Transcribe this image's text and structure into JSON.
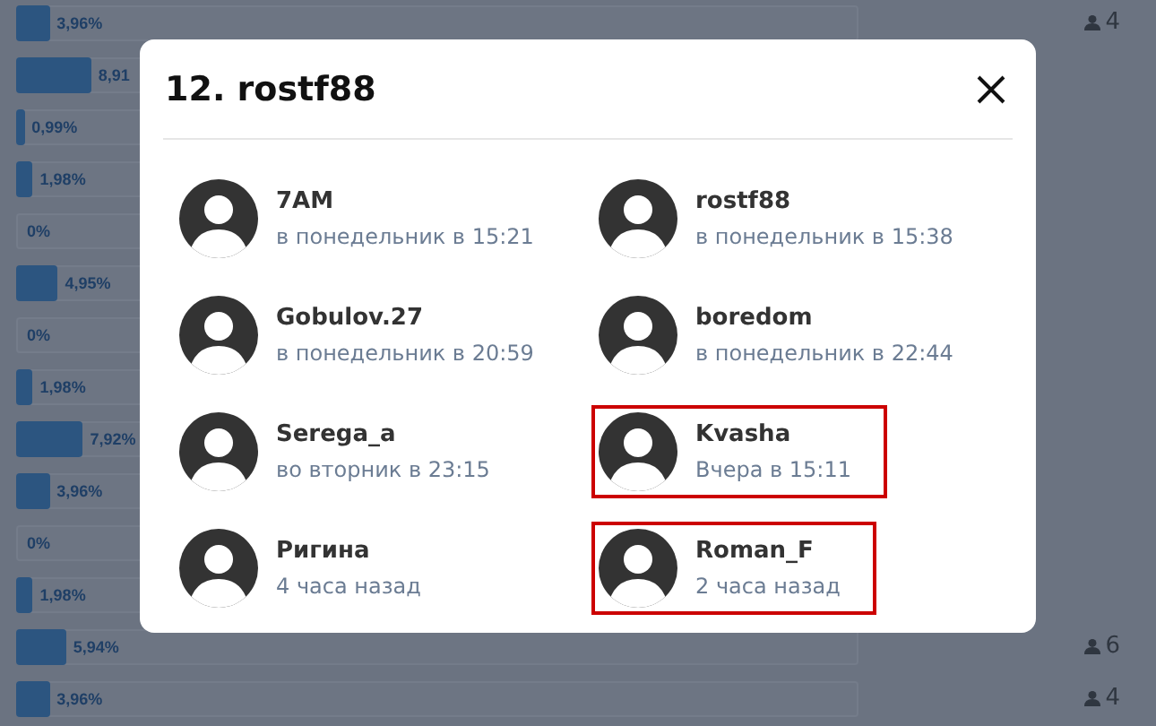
{
  "poll_rows": [
    {
      "level": 0.0396,
      "percent": "3,96%",
      "count": "4"
    },
    {
      "level": 0.0891,
      "percent": "8,91"
    },
    {
      "level": 0.0099,
      "percent": "0,99%"
    },
    {
      "level": 0.0198,
      "percent": "1,98%"
    },
    {
      "percent": "0%"
    },
    {
      "level": 0.0495,
      "percent": "4,95%"
    },
    {
      "percent": "0%"
    },
    {
      "level": 0.0198,
      "percent": "1,98%"
    },
    {
      "level": 0.0792,
      "percent": "7,92%"
    },
    {
      "level": 0.0396,
      "percent": "3,96%"
    },
    {
      "percent": "0%"
    },
    {
      "level": 0.0198,
      "percent": "1,98%"
    },
    {
      "level": 0.0594,
      "percent": "5,94%",
      "count": "6"
    },
    {
      "level": 0.0396,
      "percent": "3,96%",
      "count": "4"
    }
  ],
  "modal": {
    "title": "12. rostf88",
    "voters": [
      {
        "name": "7AM",
        "time": "в понедельник в 15:21",
        "highlighted": false
      },
      {
        "name": "rostf88",
        "time": "в понедельник в 15:38",
        "highlighted": false
      },
      {
        "name": "Gobulov.27",
        "time": "в понедельник в 20:59",
        "highlighted": false
      },
      {
        "name": "boredom",
        "time": "в понедельник в 22:44",
        "highlighted": false
      },
      {
        "name": "Serega_a",
        "time": "во вторник в 23:15",
        "highlighted": false
      },
      {
        "name": "Kvasha",
        "time": "Вчера в 15:11",
        "highlighted": true
      },
      {
        "name": "Ригина",
        "time": "4 часа назад",
        "highlighted": false
      },
      {
        "name": "Roman_F",
        "time": "2 часа назад",
        "highlighted": true
      }
    ]
  }
}
